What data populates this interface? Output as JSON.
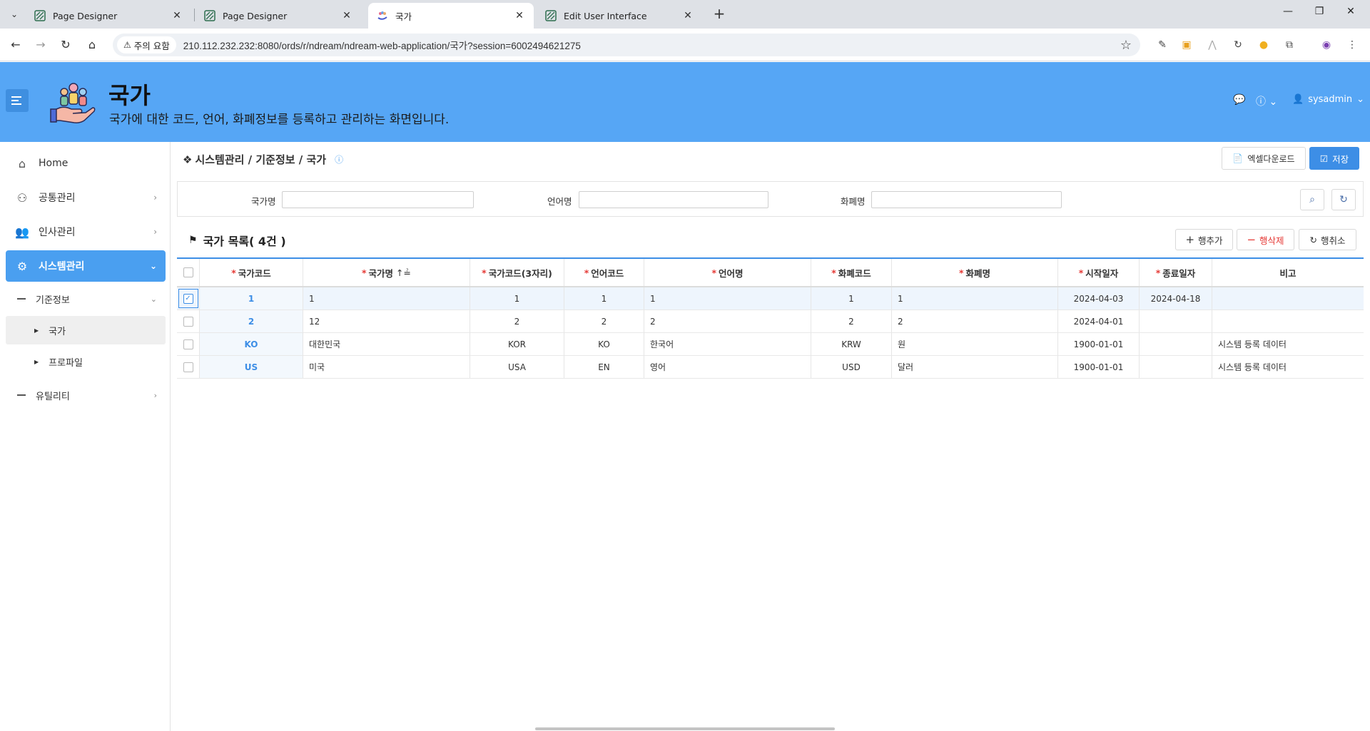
{
  "browser": {
    "tabs": [
      {
        "title": "Page Designer",
        "active": false
      },
      {
        "title": "Page Designer",
        "active": false
      },
      {
        "title": "국가",
        "active": true
      },
      {
        "title": "Edit User Interface",
        "active": false
      }
    ],
    "security_chip": "주의 요함",
    "url": "210.112.232.232:8080/ords/r/ndream/ndream-web-application/국가?session=6002494621275"
  },
  "header": {
    "title": "국가",
    "description": "국가에 대한 코드, 언어, 화폐정보를 등록하고 관리하는 화면입니다.",
    "user": "sysadmin",
    "accent": "#56a6f5"
  },
  "sidebar": {
    "home": "Home",
    "common": "공통관리",
    "hr": "인사관리",
    "system": "시스템관리",
    "base_info": "기준정보",
    "country": "국가",
    "profile": "프로파일",
    "utility": "유틸리티"
  },
  "breadcrumb": "시스템관리 / 기준정보 / 국가",
  "toolbar": {
    "excel_label": "엑셀다운로드",
    "save_label": "저장"
  },
  "search": {
    "country_name_label": "국가명",
    "language_name_label": "언어명",
    "currency_name_label": "화폐명"
  },
  "grid": {
    "title": "국가 목록( 4건 )",
    "add_row": "행추가",
    "delete_row": "행삭제",
    "cancel_row": "행취소",
    "columns": [
      "국가코드",
      "국가명",
      "국가코드(3자리)",
      "언어코드",
      "언어명",
      "화폐코드",
      "화폐명",
      "시작일자",
      "종료일자",
      "비고"
    ],
    "sort_indicator": "↑≟",
    "rows": [
      {
        "code": "1",
        "name": "1",
        "code3": "1",
        "lang_code": "1",
        "lang_name": "1",
        "cur_code": "1",
        "cur_name": "1",
        "start": "2024-04-03",
        "end": "2024-04-18",
        "note": "",
        "checked": true
      },
      {
        "code": "2",
        "name": "12",
        "code3": "2",
        "lang_code": "2",
        "lang_name": "2",
        "cur_code": "2",
        "cur_name": "2",
        "start": "2024-04-01",
        "end": "",
        "note": "",
        "checked": false
      },
      {
        "code": "KO",
        "name": "대한민국",
        "code3": "KOR",
        "lang_code": "KO",
        "lang_name": "한국어",
        "cur_code": "KRW",
        "cur_name": "원",
        "start": "1900-01-01",
        "end": "",
        "note": "시스템 등록 데이터",
        "checked": false
      },
      {
        "code": "US",
        "name": "미국",
        "code3": "USA",
        "lang_code": "EN",
        "lang_name": "영어",
        "cur_code": "USD",
        "cur_name": "달러",
        "start": "1900-01-01",
        "end": "",
        "note": "시스템 등록 데이터",
        "checked": false
      }
    ]
  }
}
